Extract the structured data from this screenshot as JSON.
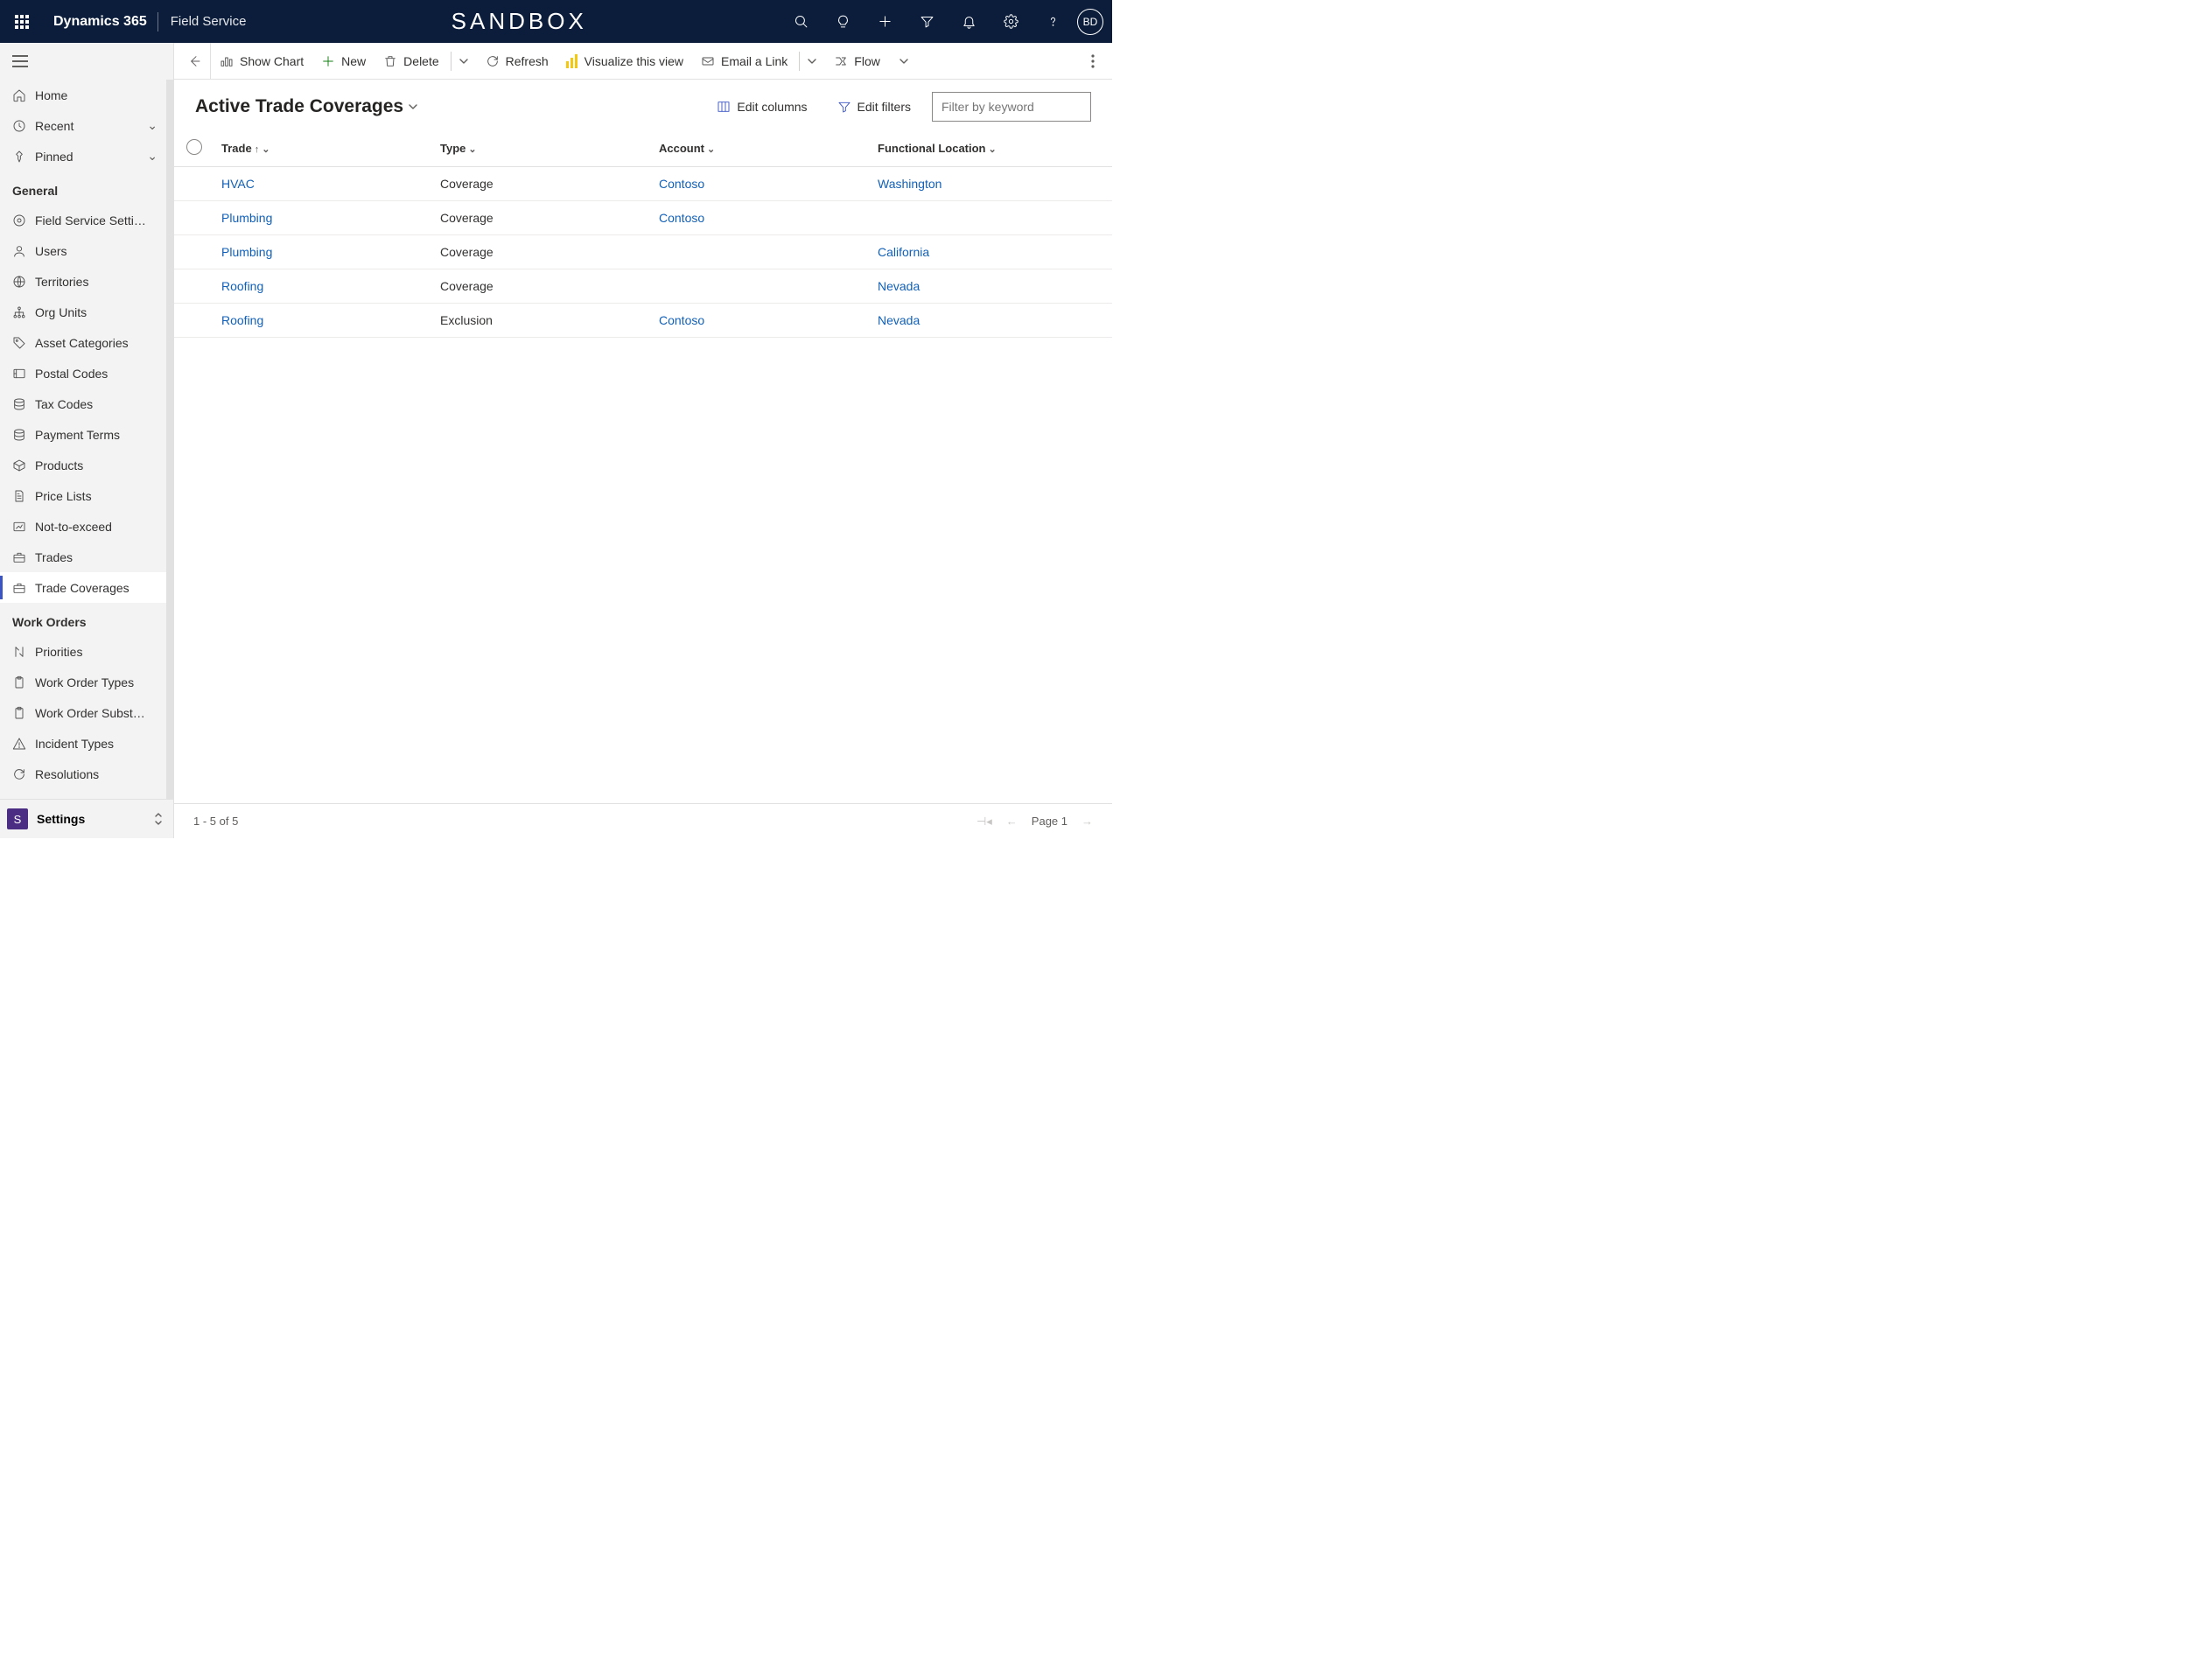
{
  "topbar": {
    "brand": "Dynamics 365",
    "app": "Field Service",
    "env": "SANDBOX",
    "avatar": "BD"
  },
  "sidebar": {
    "top": [
      {
        "icon": "home",
        "label": "Home"
      },
      {
        "icon": "clock",
        "label": "Recent",
        "expand": true
      },
      {
        "icon": "pin",
        "label": "Pinned",
        "expand": true
      }
    ],
    "sections": [
      {
        "title": "General",
        "items": [
          {
            "icon": "gear",
            "label": "Field Service Setti…"
          },
          {
            "icon": "person",
            "label": "Users"
          },
          {
            "icon": "globe",
            "label": "Territories"
          },
          {
            "icon": "org",
            "label": "Org Units"
          },
          {
            "icon": "tag",
            "label": "Asset Categories"
          },
          {
            "icon": "postal",
            "label": "Postal Codes"
          },
          {
            "icon": "db",
            "label": "Tax Codes"
          },
          {
            "icon": "db",
            "label": "Payment Terms"
          },
          {
            "icon": "box",
            "label": "Products"
          },
          {
            "icon": "doc",
            "label": "Price Lists"
          },
          {
            "icon": "nte",
            "label": "Not-to-exceed"
          },
          {
            "icon": "briefcase",
            "label": "Trades"
          },
          {
            "icon": "briefcase",
            "label": "Trade Coverages",
            "active": true
          }
        ]
      },
      {
        "title": "Work Orders",
        "items": [
          {
            "icon": "priority",
            "label": "Priorities"
          },
          {
            "icon": "clipboard",
            "label": "Work Order Types"
          },
          {
            "icon": "clipboard",
            "label": "Work Order Subst…"
          },
          {
            "icon": "warn",
            "label": "Incident Types"
          },
          {
            "icon": "refresh",
            "label": "Resolutions"
          }
        ]
      }
    ],
    "area": {
      "initial": "S",
      "label": "Settings"
    }
  },
  "cmdbar": {
    "show_chart": "Show Chart",
    "new": "New",
    "delete": "Delete",
    "refresh": "Refresh",
    "visualize": "Visualize this view",
    "email": "Email a Link",
    "flow": "Flow"
  },
  "view": {
    "title": "Active Trade Coverages",
    "edit_columns": "Edit columns",
    "edit_filters": "Edit filters",
    "filter_placeholder": "Filter by keyword"
  },
  "columns": {
    "trade": "Trade",
    "type": "Type",
    "account": "Account",
    "location": "Functional Location"
  },
  "rows": [
    {
      "trade": "HVAC",
      "type": "Coverage",
      "account": "Contoso",
      "location": "Washington"
    },
    {
      "trade": "Plumbing",
      "type": "Coverage",
      "account": "Contoso",
      "location": ""
    },
    {
      "trade": "Plumbing",
      "type": "Coverage",
      "account": "",
      "location": "California"
    },
    {
      "trade": "Roofing",
      "type": "Coverage",
      "account": "",
      "location": "Nevada"
    },
    {
      "trade": "Roofing",
      "type": "Exclusion",
      "account": "Contoso",
      "location": "Nevada"
    }
  ],
  "status": {
    "range": "1 - 5 of 5",
    "page": "Page 1"
  }
}
